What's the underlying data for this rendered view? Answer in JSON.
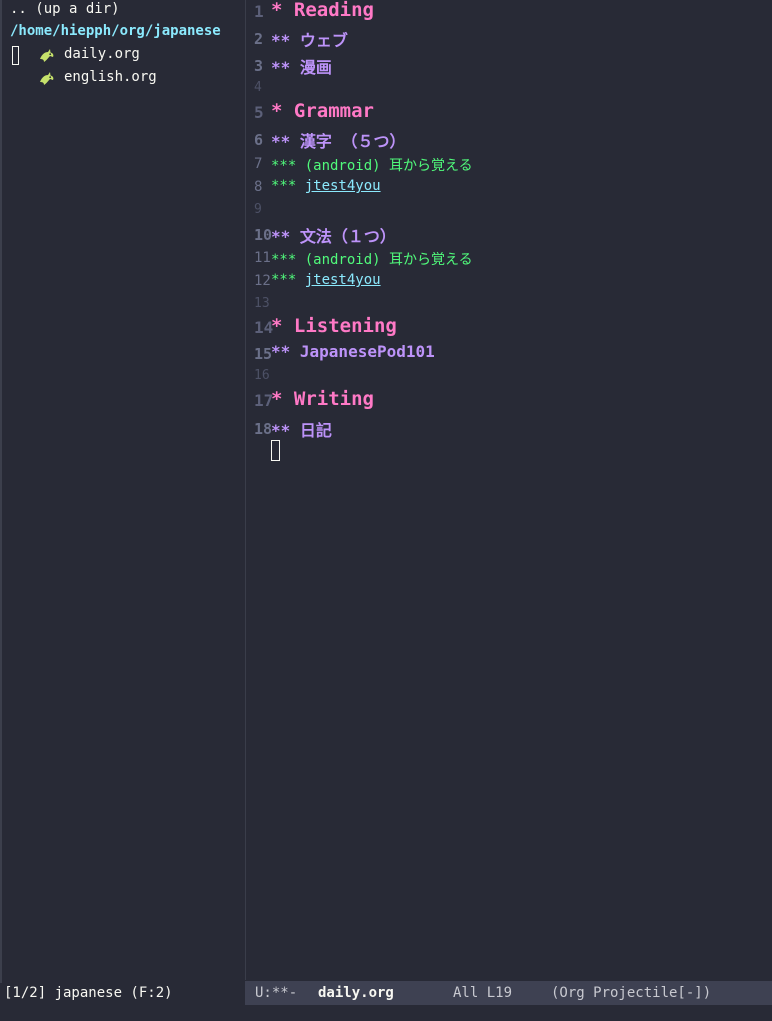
{
  "sidebar": {
    "up_dir": ".. (up a dir)",
    "root_path": "/home/hiepph/org/japanese",
    "files": [
      {
        "name": "daily.org",
        "icon": "org-unicorn-icon"
      },
      {
        "name": "english.org",
        "icon": "org-unicorn-icon"
      }
    ],
    "modeline": "[1/2] japanese (F:2)"
  },
  "editor": {
    "lines": [
      {
        "n": "1",
        "text": "* Reading"
      },
      {
        "n": "2",
        "text": "** ウェブ"
      },
      {
        "n": "3",
        "text": "** 漫画"
      },
      {
        "n": "4",
        "text": ""
      },
      {
        "n": "5",
        "text": "* Grammar"
      },
      {
        "n": "6",
        "text": "** 漢字 （５つ）"
      },
      {
        "n": "7",
        "text": "*** (android) 耳から覚える"
      },
      {
        "n": "8",
        "stars": "*** ",
        "link": "jtest4you"
      },
      {
        "n": "9",
        "text": ""
      },
      {
        "n": "10",
        "text": "** 文法（１つ）"
      },
      {
        "n": "11",
        "text": "*** (android) 耳から覚える"
      },
      {
        "n": "12",
        "stars": "*** ",
        "link": "jtest4you"
      },
      {
        "n": "13",
        "text": ""
      },
      {
        "n": "14",
        "text": "* Listening"
      },
      {
        "n": "15",
        "text": "** JapanesePod101"
      },
      {
        "n": "16",
        "text": ""
      },
      {
        "n": "17",
        "text": "* Writing"
      },
      {
        "n": "18",
        "text": "** 日記"
      }
    ]
  },
  "modeline": {
    "state": "U:**-",
    "buffer": "daily.org",
    "position": "All L19",
    "modes": "(Org Projectile[-])"
  },
  "colors": {
    "background": "#282a36",
    "heading1": "#ff79c6",
    "heading2": "#bd93f9",
    "heading3": "#50fa7b",
    "link": "#8be9fd",
    "modeline_bg": "#3e4152"
  }
}
